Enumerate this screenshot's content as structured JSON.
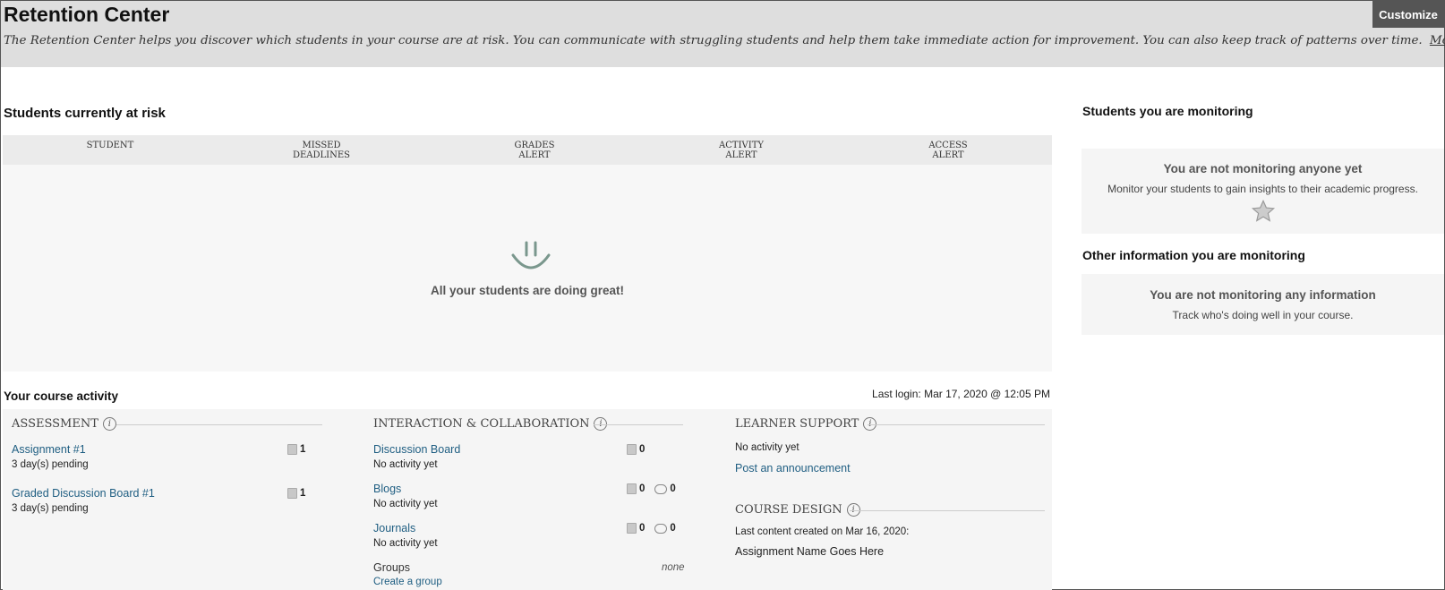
{
  "header": {
    "title": "Retention Center",
    "description": "The Retention Center helps you discover which students in your course are at risk. You can communicate with struggling students and help them take immediate action for improvement. You can also keep track of patterns over time.",
    "help_link": "More Help",
    "customize_label": "Customize"
  },
  "risk": {
    "title": "Students currently at risk",
    "columns": [
      "STUDENT",
      "MISSED\nDEADLINES",
      "GRADES\nALERT",
      "ACTIVITY\nALERT",
      "ACCESS\nALERT"
    ],
    "empty_message": "All your students are doing great!"
  },
  "monitoring": {
    "students_title": "Students you are monitoring",
    "students_empty_heading": "You are not monitoring anyone yet",
    "students_empty_text": "Monitor your students to gain insights to their academic progress.",
    "info_title": "Other information you are monitoring",
    "info_empty_heading": "You are not monitoring any information",
    "info_empty_text": "Track who's doing well in your course."
  },
  "activity": {
    "title": "Your course activity",
    "last_login": "Last login: Mar 17, 2020 @ 12:05 PM",
    "assessment": {
      "label": "ASSESSMENT",
      "items": [
        {
          "name": "Assignment #1",
          "status": "3 day(s) pending",
          "count": "1"
        },
        {
          "name": "Graded Discussion Board #1",
          "status": "3 day(s) pending",
          "count": "1"
        }
      ]
    },
    "interaction": {
      "label": "INTERACTION & COLLABORATION",
      "items": [
        {
          "name": "Discussion Board",
          "status": "No activity yet",
          "count": "0"
        },
        {
          "name": "Blogs",
          "status": "No activity yet",
          "count": "0",
          "comments": "0"
        },
        {
          "name": "Journals",
          "status": "No activity yet",
          "count": "0",
          "comments": "0"
        }
      ],
      "groups_label": "Groups",
      "groups_value": "none",
      "create_group": "Create a group"
    },
    "learner_support": {
      "label": "LEARNER SUPPORT",
      "status": "No activity yet",
      "post_link": "Post an announcement"
    },
    "course_design": {
      "label": "COURSE DESIGN",
      "last_content": "Last content created on Mar 16, 2020:",
      "content_name": "Assignment Name Goes Here"
    }
  },
  "icons": {
    "info": "info-icon",
    "star": "star-icon",
    "smile": "smiley-icon",
    "document": "document-icon",
    "comment": "comment-icon"
  }
}
